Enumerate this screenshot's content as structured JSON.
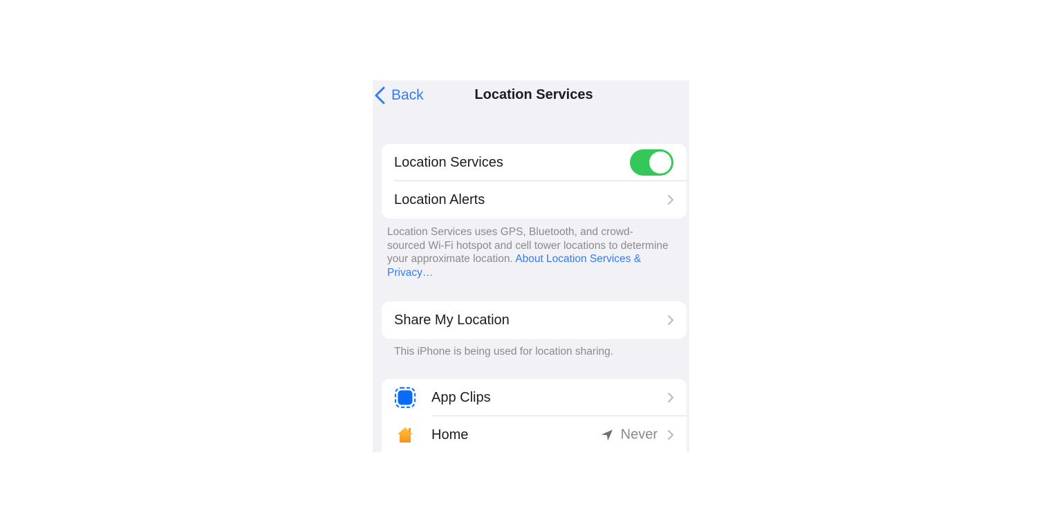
{
  "nav": {
    "back_label": "Back",
    "back_icon": "chevron-left-icon",
    "title": "Location Services"
  },
  "colors": {
    "accent": "#2f7cf6",
    "toggle_on": "#34c759",
    "background": "#f2f2f6",
    "secondary_text": "#8a8a8e",
    "home_icon": "#f9a825"
  },
  "group1": {
    "location_services": {
      "label": "Location Services",
      "toggle_on": true
    },
    "location_alerts": {
      "label": "Location Alerts",
      "icon": "chevron-right-icon"
    }
  },
  "footer1": {
    "text": "Location Services uses GPS, Bluetooth, and crowd-sourced Wi-Fi hotspot and cell tower locations to determine your approximate location. ",
    "link": "About Location Services & Privacy…"
  },
  "group2": {
    "share_my_location": {
      "label": "Share My Location",
      "icon": "chevron-right-icon"
    }
  },
  "footer2": {
    "text": "This iPhone is being used for location sharing."
  },
  "apps": [
    {
      "label": "App Clips",
      "icon": "app-clips-icon",
      "value": ""
    },
    {
      "label": "Home",
      "icon": "home-icon",
      "value": "Never",
      "value_icon": "location-arrow-icon"
    }
  ]
}
